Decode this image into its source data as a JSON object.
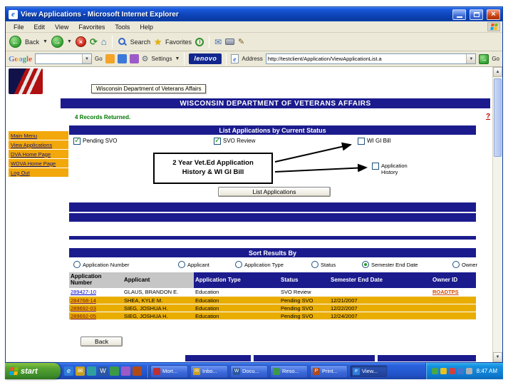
{
  "colors": {
    "navy_bar": "#1B1B8E",
    "gold_row": "#E9AD00",
    "sidebar_gold": "#F2A70A",
    "records_green": "#007800",
    "link_blue": "#0000C8",
    "owner_link_orange": "#D04A00",
    "taskbar_blue": "#2A63DE",
    "start_green": "#57A434"
  },
  "titlebar": {
    "title": "View Applications - Microsoft Internet Explorer"
  },
  "menubar": {
    "items": [
      "File",
      "Edit",
      "View",
      "Favorites",
      "Tools",
      "Help"
    ]
  },
  "toolbar": {
    "back": "Back",
    "search": "Search",
    "favorites": "Favorites"
  },
  "googlebar": {
    "logo": "Google",
    "go": "Go",
    "settings": "Settings",
    "lenovo": "lenovo",
    "address_label": "Address",
    "address_value": "http://testclient/Application/ViewApplicationList.a",
    "go_button": "Go"
  },
  "sidebar": {
    "items": [
      "Main Menu",
      "View Applications",
      "DVA Home Page",
      "WDVA Home Page",
      "Log Out"
    ]
  },
  "page": {
    "logo_tooltip": "Wisconsin Department of Veterans Affairs",
    "banner": "WISCONSIN DEPARTMENT OF VETERANS AFFAIRS",
    "records": "4 Records Returned.",
    "help": "?",
    "filter_title": "List Applications by Current Status",
    "checkboxes": [
      {
        "label": "Pending SVO",
        "checked": true
      },
      {
        "label": "SVO Review",
        "checked": true
      },
      {
        "label": "WI GI Bill",
        "checked": false
      },
      {
        "label": "Application History",
        "checked": false
      }
    ],
    "callout": "2 Year Vet.Ed Application History & WI GI Bill",
    "list_button": "List Applications",
    "sort_title": "Sort Results By",
    "sort_options": [
      {
        "label": "Application Number",
        "selected": false
      },
      {
        "label": "Applicant",
        "selected": false
      },
      {
        "label": "Application Type",
        "selected": false
      },
      {
        "label": "Status",
        "selected": false
      },
      {
        "label": "Semester End Date",
        "selected": true
      },
      {
        "label": "Owner",
        "selected": false
      }
    ],
    "table": {
      "headers": [
        "Application Number",
        "Applicant",
        "Application Type",
        "Status",
        "Semester End Date",
        "Owner ID"
      ],
      "rows": [
        {
          "number": "289427-10",
          "applicant": "GLAUS, BRANDON E.",
          "type": "Education",
          "status": "SVO Review",
          "end_date": "",
          "owner": "ROADTPS"
        },
        {
          "number": "284768-14",
          "applicant": "SHEA, KYLE M.",
          "type": "Education",
          "status": "Pending SVO",
          "end_date": "12/21/2007",
          "owner": ""
        },
        {
          "number": "289692-03",
          "applicant": "SIEG, JOSHUA H.",
          "type": "Education",
          "status": "Pending SVO",
          "end_date": "12/22/2007",
          "owner": ""
        },
        {
          "number": "289692-05",
          "applicant": "SIEG, JOSHUA H.",
          "type": "Education",
          "status": "Pending SVO",
          "end_date": "12/24/2007",
          "owner": ""
        }
      ]
    },
    "back_button": "Back"
  },
  "taskbar": {
    "start": "start",
    "buttons": [
      "Mort...",
      "Inbo...",
      "Docu...",
      "Reso...",
      "Print...",
      "View..."
    ],
    "clock": "8:47 AM"
  }
}
